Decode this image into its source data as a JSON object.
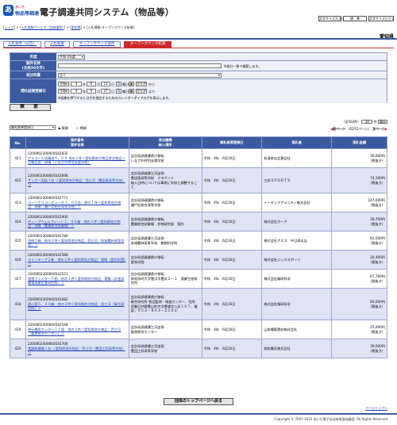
{
  "header": {
    "logo_mark": "あ",
    "logo_top": "あいち",
    "logo_bottom": "物品等調達",
    "title": "電子調達共同システム（物品等）",
    "font_large": "文字サイズ大きく",
    "font_std": "標　準",
    "font_small": "文字サイズ小さく"
  },
  "breadcrumb": {
    "top": "トップ",
    "info": "入札情報サービス（団体選択）",
    "pref": "愛知県",
    "current": "入札情報-オープンカウンタ結果",
    "sep": " > "
  },
  "prefecture": "愛知県",
  "tabs": [
    "入札案件（公告）",
    "入札結果",
    "オープンカウンタ案件",
    "オープンカウンタ結果"
  ],
  "form": {
    "year_label": "年度",
    "year_value": "令和 4年度",
    "case_label_1": "案件名称",
    "case_label_2": "(全角50文字)",
    "case_note": "※部分一致で検索します。",
    "dept_label": "発注所属",
    "dept_value": "全て",
    "date_label": "開札結果登録日",
    "date1": {
      "era": "令和",
      "y": "4",
      "m": "6",
      "d": "13",
      "dow": "月",
      "cal": "曜日",
      "clear": "クリア",
      "suffix": "から"
    },
    "date2": {
      "era": "令和",
      "y": "4",
      "m": "6",
      "d": "27",
      "dow": "月",
      "cal": "曜日",
      "clear": "クリア",
      "suffix": "まで"
    },
    "y_unit": "年",
    "m_unit": "月",
    "d_unit": "日",
    "date_note": "※画像を押下すると日付を指定するためのカレンダーダイアログを表示します。",
    "search_button": "検　索"
  },
  "controls": {
    "sort_value": "開札結果登録日",
    "asc": "昇順",
    "desc": "降順",
    "total": "（全502件）",
    "per_page": "10",
    "per_unit": "件",
    "display": "表示",
    "prev": "前ページ",
    "page": "（42/51ページ）",
    "next": "次ページ"
  },
  "table": {
    "headers": {
      "no": "No.",
      "case_1": "案件番号",
      "case_2": "案件名称",
      "dept_1": "発注機関",
      "dept_2": "納入場所",
      "date": "開札結果登録日",
      "winner": "落札者",
      "price": "落札金額"
    },
    "tax_note": "（税抜き）",
    "rows": [
      {
        "no": "411",
        "id": "2200002300000542832",
        "name": "アルコール消毒液４，００ 他の１件＜愛知県他方物品他方物品＞",
        "name2": "方物品会：現場（いなざわ特別支援学校）",
        "dept": "会計局調達課県庁移転",
        "place": "いなざわ特別支援学校",
        "date": "令和　4年　6月16日",
        "winner": "松清本店会資会社",
        "price": "36,600円"
      },
      {
        "no": "412",
        "id": "2200002300000542698",
        "name": "サッカー用具１台 ＜愛知県他方物品：西三河（豊田東高等学校）＞",
        "name2": "",
        "dept": "会計局調達課三河出張",
        "place": "豊田東高等学校　グラウンド\n納入日時については事前に学校と調整すること",
        "date": "令和　4年　6月16日",
        "winner": "三好ＳＰＯＲＴＳ",
        "price": "74,100円"
      },
      {
        "no": "413",
        "id": "2200002300000542771",
        "name": "パーソナルコンピュータ１，００台　他の１件＜愛知県他方物品：現場（瀬戸北総合高等学校）＞",
        "name2": "",
        "dept": "会計局調達課県庁移転",
        "place": "瀬戸北総合高等学校",
        "date": "令和　4年　6月16日",
        "winner": "トーテックアメニティ株式会社",
        "price": "147,000円"
      },
      {
        "no": "414",
        "id": "2200002300000542900",
        "name": "ディープウェルプレート１，００箱　他の１件＜愛知県他方物品：現場（農業総合試験場）＞",
        "name2": "",
        "dept": "会計局調達課県庁移転",
        "place": "農業総合試験場　作物研究部　稲作",
        "date": "令和　4年　6月16日",
        "winner": "株式会社カーク",
        "price": "39,700円"
      },
      {
        "no": "415",
        "id": "2200002300000542789",
        "name": "洗剤５箱　他の２件＜愛知県他方物品：西三河（安城農林高等学校）＞",
        "name2": "",
        "dept": "会計局調達課三河出張",
        "place": "安城農林高等学校　動物科学科",
        "date": "令和　4年　6月16日",
        "winner": "株式会社アスコ　中日本支店",
        "price": "62,500円"
      },
      {
        "no": "416",
        "id": "2200002300000542589",
        "name": "ラインテープ２巻　他の１件＜愛知県他方物品：現場（愛知学園）＞",
        "name2": "",
        "dept": "会計局調達課県庁移転",
        "place": "愛知学園",
        "date": "令和　4年　6月16日",
        "winner": "株式会社ニシオスポーツ",
        "price": "26,400円"
      },
      {
        "no": "417",
        "id": "2200002300000542521",
        "name": "濾過フィルター５個　他の１件＜愛知県他方物品：現場（水産試験場漁業生産研究所）＞",
        "name2": "",
        "dept": "会計局調達課県庁移転",
        "place": "南知多町大字豊浜字豊浜２－１　漁業生産研究所",
        "date": "令和　4年　6月16日",
        "winner": "株式会社榮研科学",
        "price": "67,760円"
      },
      {
        "no": "418",
        "id": "2200002300000542682",
        "name": "遠心管５，００箱　他の２件＜愛知県他方物品：西三河（衛生研究所）＞",
        "name2": "",
        "dept": "会計局調達課県庁移転",
        "place": "衛生研究所 食品監視・検査センター、住所：西春日井郡豊山町大字豊場字八反１０７、電話：０５２－９０３－２１０２",
        "date": "令和　4年　6月16日",
        "winner": "株式会社榮研科学",
        "price": "60,000円"
      },
      {
        "no": "419",
        "id": "2200002300000542548",
        "name": "単元種用カッター１１個　他の２件＜愛知県他方物品：西三河（畜産総合センター）＞",
        "name2": "",
        "dept": "会計局調達課三河出張",
        "place": "畜産総合センター",
        "date": "令和　4年　6月16日",
        "winner": "山本種畜園芸株式会社",
        "price": "25,000円"
      },
      {
        "no": "420",
        "id": "2200002300000542700",
        "name": "食器乾燥機１台 ＜愛知県他方物品：西三河（豊田工科高等学校）＞",
        "name2": "",
        "dept": "会計局調達課三河出張",
        "place": "豊田工科高等学校",
        "date": "令和　4年　6月16日",
        "winner": "扇松電気株式会社",
        "price": "39,000円"
      }
    ]
  },
  "bottom": {
    "top_button": "団体のトップページへ戻る",
    "page_top": "ページトップへ",
    "copyright": "Copyright © 2007-2022 あいち電子自治体推進協議会. All Rights Reserved"
  },
  "colors": {
    "nav_blue": "#3b5aa0",
    "active_tab": "#cc2a2a",
    "row_blue": "#dfe4f4"
  }
}
